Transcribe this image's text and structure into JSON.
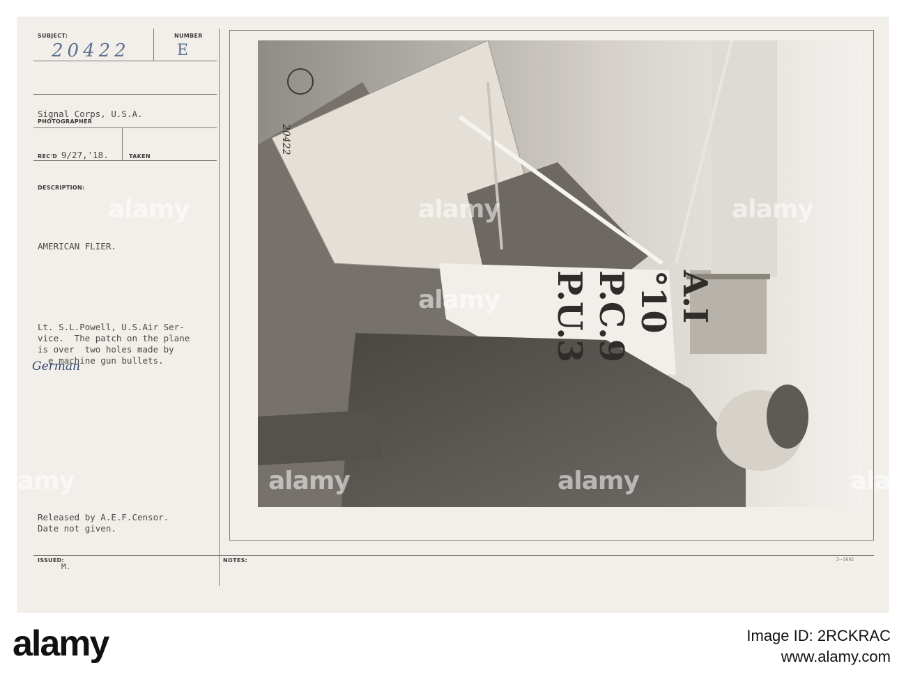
{
  "card": {
    "subject_label": "SUBJECT:",
    "subject_value": "20422",
    "number_label": "NUMBER",
    "number_value": "E",
    "photographer_value": "Signal Corps, U.S.A.",
    "photographer_label": "PHOTOGRAPHER",
    "recd_label": "REC'D",
    "recd_value": "9/27,'18.",
    "taken_label": "TAKEN",
    "description_label": "DESCRIPTION:",
    "title": "AMERICAN FLIER.",
    "desc_line1": "Lt. S.L.Powell, U.S.Air Ser-",
    "desc_line2": "vice.  The patch on the plane",
    "desc_line3": "is over  two holes made by",
    "desc_line4": "  e machine gun bullets.",
    "handwritten_word": "German",
    "released_line1": "Released by A.E.F.Censor.",
    "released_line2": "Date not given.",
    "issued_label": "ISSUED:",
    "issued_value": "M.",
    "notes_label": "NOTES:",
    "form_number": "3—5605"
  },
  "photo": {
    "stamp_number": "20422",
    "plane_text": [
      "A.I",
      "°10",
      "P.C.9",
      "P.U.3"
    ]
  },
  "watermark": "alamy",
  "footer": {
    "logo": "alamy",
    "image_id_label": "Image ID: 2RCKRAC",
    "website": "www.alamy.com"
  }
}
